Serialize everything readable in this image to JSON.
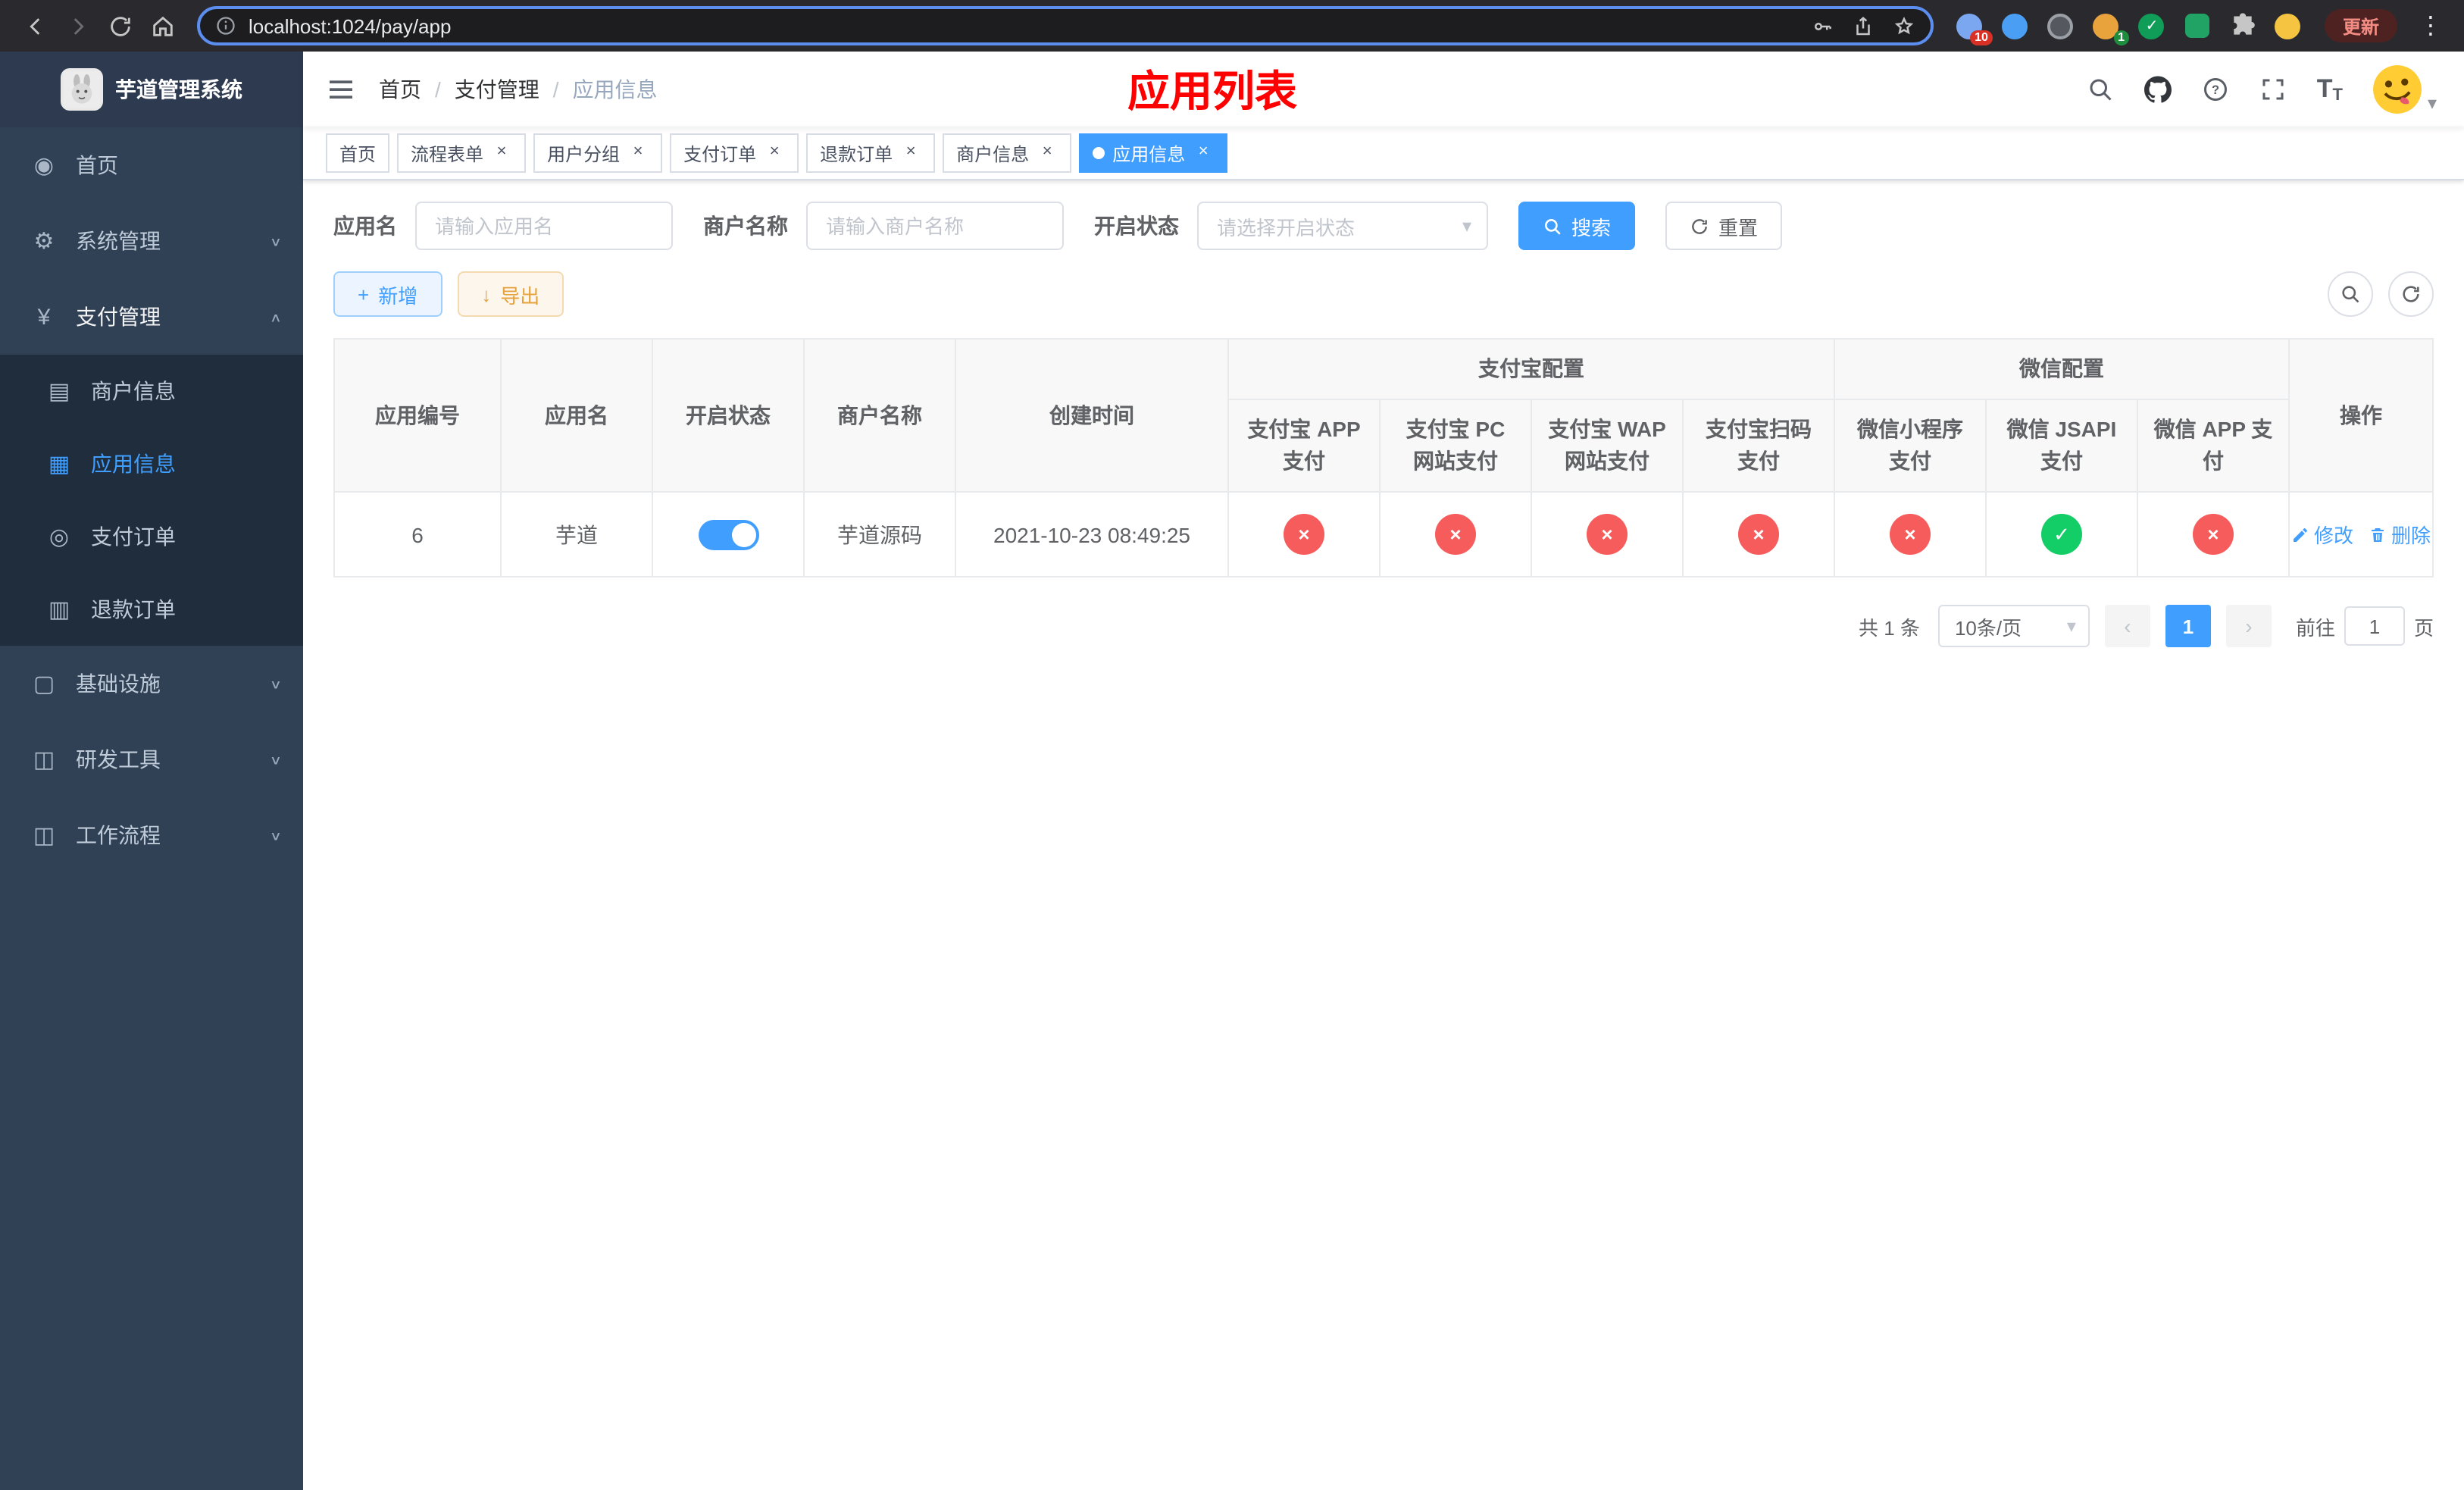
{
  "colors": {
    "primary": "#409eff",
    "danger": "#f75c5c",
    "success": "#13ce66",
    "warning": "#e6a23c",
    "title_red": "#ff0000",
    "sidebar_bg": "#304156",
    "submenu_bg": "#1f2d3d"
  },
  "icons": {
    "close": "×",
    "check": "✓",
    "cross": "×",
    "caret_down": "▾",
    "chevron_down": "∨",
    "chevron_up": "∧",
    "prev": "‹",
    "next": "›",
    "plus": "+",
    "download": "↓",
    "dot_menu": "⋮",
    "dashboard": "◉",
    "gear": "⚙",
    "yen": "¥",
    "merchant": "▤",
    "app": "▦",
    "order": "◎",
    "refund": "▥",
    "infra": "▢",
    "tools": "◫",
    "workflow": "◫",
    "font_big": "T",
    "font_small": "T"
  },
  "browser": {
    "url": "localhost:1024/pay/app",
    "update_label": "更新",
    "extension_badge": "10",
    "profile_badge": "1"
  },
  "sidebar": {
    "logo_title": "芋道管理系统",
    "menu": [
      {
        "label": "首页"
      },
      {
        "label": "系统管理"
      },
      {
        "label": "支付管理"
      },
      {
        "label": "商户信息"
      },
      {
        "label": "应用信息"
      },
      {
        "label": "支付订单"
      },
      {
        "label": "退款订单"
      },
      {
        "label": "基础设施"
      },
      {
        "label": "研发工具"
      },
      {
        "label": "工作流程"
      }
    ]
  },
  "header": {
    "breadcrumb": {
      "home": "首页",
      "section": "支付管理",
      "current": "应用信息",
      "separator": "/"
    },
    "page_title": "应用列表"
  },
  "tabs": [
    {
      "label": "首页"
    },
    {
      "label": "流程表单"
    },
    {
      "label": "用户分组"
    },
    {
      "label": "支付订单"
    },
    {
      "label": "退款订单"
    },
    {
      "label": "商户信息"
    },
    {
      "label": "应用信息"
    }
  ],
  "filters": {
    "app_name_label": "应用名",
    "app_name_placeholder": "请输入应用名",
    "merchant_label": "商户名称",
    "merchant_placeholder": "请输入商户名称",
    "status_label": "开启状态",
    "status_placeholder": "请选择开启状态",
    "search_label": "搜索",
    "reset_label": "重置"
  },
  "toolbar": {
    "add_label": "新增",
    "export_label": "导出"
  },
  "table": {
    "header": {
      "app_id": "应用编号",
      "app_name": "应用名",
      "status": "开启状态",
      "merchant": "商户名称",
      "created": "创建时间",
      "alipay_group": "支付宝配置",
      "wechat_group": "微信配置",
      "alipay_app": "支付宝 APP 支付",
      "alipay_pc": "支付宝 PC 网站支付",
      "alipay_wap": "支付宝 WAP 网站支付",
      "alipay_qr": "支付宝扫码支付",
      "wechat_lite": "微信小程序支付",
      "wechat_jsapi": "微信 JSAPI 支付",
      "wechat_app": "微信 APP 支付",
      "ops": "操作"
    },
    "row": {
      "app_id": "6",
      "app_name": "芋道",
      "status_on": true,
      "merchant": "芋道源码",
      "created": "2021-10-23 08:49:25",
      "configs": {
        "alipay_app": "disabled",
        "alipay_pc": "disabled",
        "alipay_wap": "disabled",
        "alipay_qr": "disabled",
        "wechat_lite": "disabled",
        "wechat_jsapi": "enabled",
        "wechat_app": "disabled"
      },
      "edit_label": "修改",
      "delete_label": "删除"
    }
  },
  "pagination": {
    "total_text": "共 1 条",
    "page_size": "10条/页",
    "current_page": "1",
    "goto_prefix": "前往",
    "goto_value": "1",
    "goto_suffix": "页"
  }
}
